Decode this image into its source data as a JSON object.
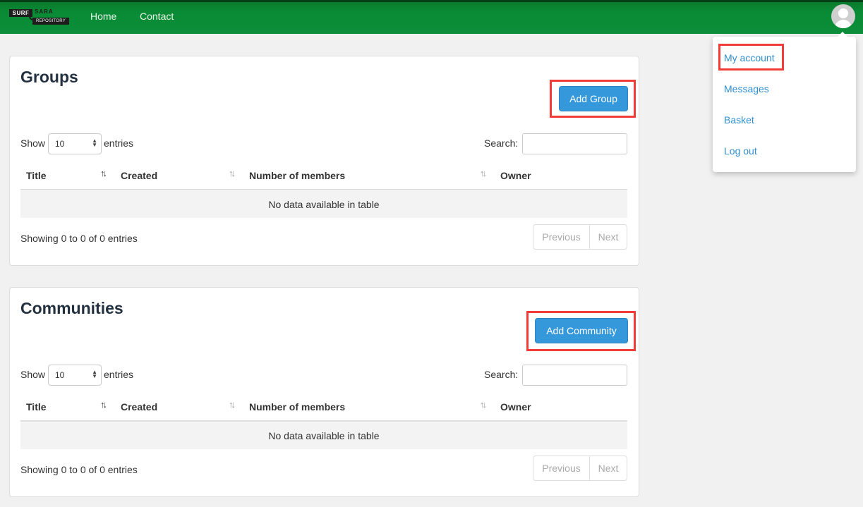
{
  "navbar": {
    "logo": {
      "surf": "SURF",
      "sara": "SARA",
      "repository": "REPOSITORY"
    },
    "links": [
      "Home",
      "Contact"
    ],
    "avatar_icon": "user-avatar-icon"
  },
  "user_menu": {
    "items": [
      "My account",
      "Messages",
      "Basket",
      "Log out"
    ],
    "highlighted_item": "My account"
  },
  "groups_panel": {
    "title": "Groups",
    "add_button": "Add Group",
    "show_label": "Show",
    "page_length": "10",
    "entries_label": "entries",
    "search_label": "Search:",
    "search_value": "",
    "columns": [
      "Title",
      "Created",
      "Number of members",
      "Owner"
    ],
    "empty_message": "No data available in table",
    "info": "Showing 0 to 0 of 0 entries",
    "prev_label": "Previous",
    "next_label": "Next"
  },
  "communities_panel": {
    "title": "Communities",
    "add_button": "Add Community",
    "show_label": "Show",
    "page_length": "10",
    "entries_label": "entries",
    "search_label": "Search:",
    "search_value": "",
    "columns": [
      "Title",
      "Created",
      "Number of members",
      "Owner"
    ],
    "empty_message": "No data available in table",
    "info": "Showing 0 to 0 of 0 entries",
    "prev_label": "Previous",
    "next_label": "Next"
  },
  "colors": {
    "navbar": "#0c8f3a",
    "primary_button": "#3498db",
    "link": "#2f8fcf",
    "highlight_box": "#f23c37"
  }
}
